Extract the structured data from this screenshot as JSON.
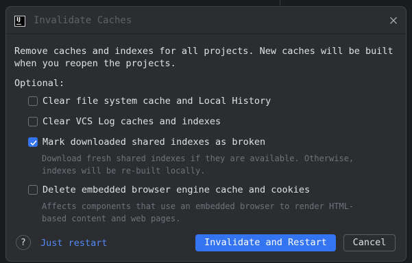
{
  "dialog": {
    "title": "Invalidate Caches",
    "description": "Remove caches and indexes for all projects. New caches will be built when you reopen the projects.",
    "optional_label": "Optional:",
    "options": [
      {
        "label": "Clear file system cache and Local History",
        "checked": false,
        "hint": ""
      },
      {
        "label": "Clear VCS Log caches and indexes",
        "checked": false,
        "hint": ""
      },
      {
        "label": "Mark downloaded shared indexes as broken",
        "checked": true,
        "hint": "Download fresh shared indexes if they are available. Otherwise, indexes will be re-built locally."
      },
      {
        "label": "Delete embedded browser engine cache and cookies",
        "checked": false,
        "hint": "Affects components that use an embedded browser to render HTML-based content and web pages."
      }
    ],
    "help_symbol": "?",
    "just_restart_label": "Just restart",
    "primary_button_label": "Invalidate and Restart",
    "cancel_button_label": "Cancel"
  },
  "colors": {
    "accent": "#3574f0",
    "link": "#548af7",
    "background": "#2b2d30",
    "text": "#dfe1e5",
    "muted": "#6f737a"
  },
  "icons": {
    "app": "intellij-app-icon",
    "close": "close-icon",
    "check": "check-icon",
    "help": "help-icon"
  }
}
